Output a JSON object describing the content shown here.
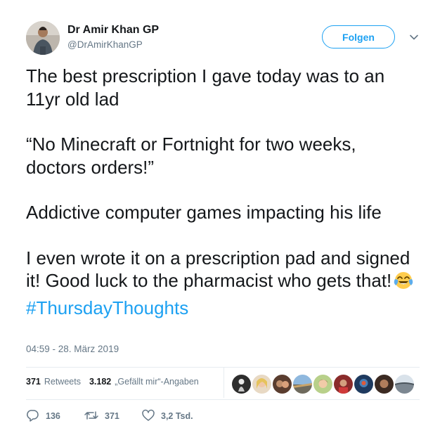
{
  "author": {
    "name": "Dr Amir Khan GP",
    "handle": "@DrAmirKhanGP"
  },
  "follow_label": "Folgen",
  "tweet": {
    "line1": "The best prescription I gave today was to an 11yr old lad",
    "line2": "“No Minecraft or Fortnight for two weeks, doctors orders!”",
    "line3": "Addictive computer games impacting his life",
    "line4": "I even wrote it on a prescription pad and signed it! Good luck to the pharmacist who gets that!",
    "emoji": "face-with-tears-of-joy",
    "hashtag": "#ThursdayThoughts"
  },
  "timestamp": "04:59 - 28. März 2019",
  "stats": {
    "retweets_count": "371",
    "retweets_label": "Retweets",
    "likes_count": "3.182",
    "likes_label": "„Gefällt mir“-Angaben"
  },
  "actions": {
    "reply_count": "136",
    "retweet_count": "371",
    "like_count": "3,2 Tsd."
  },
  "colors": {
    "accent": "#1da1f2",
    "text": "#14171a",
    "secondary": "#657786",
    "divider": "#e6ecf0"
  }
}
